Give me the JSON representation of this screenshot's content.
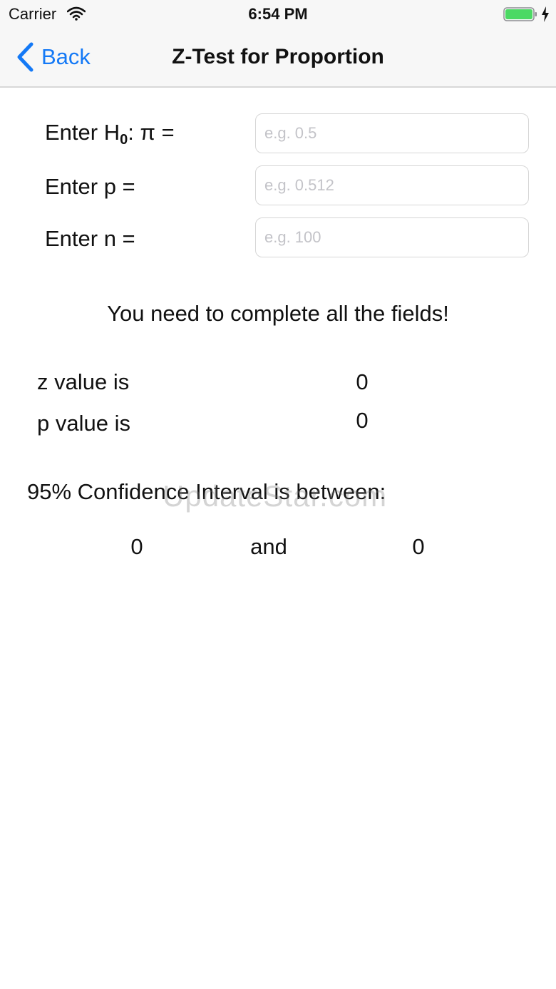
{
  "status_bar": {
    "carrier": "Carrier",
    "time": "6:54 PM"
  },
  "nav": {
    "back_label": "Back",
    "title": "Z-Test for Proportion"
  },
  "form": {
    "h0": {
      "label_prefix": "Enter H",
      "label_subscript": "0",
      "label_suffix": ": π =",
      "placeholder": "e.g. 0.5",
      "value": ""
    },
    "p": {
      "label": "Enter p =",
      "placeholder": "e.g. 0.512",
      "value": ""
    },
    "n": {
      "label": "Enter n =",
      "placeholder": "e.g. 100",
      "value": ""
    }
  },
  "message": "You need to complete all the fields!",
  "results": {
    "z_label": "z value is",
    "z_value": "0",
    "p_label": "p value is",
    "p_value": "0"
  },
  "confidence_interval": {
    "heading": "95% Confidence Interval is between:",
    "lower": "0",
    "connector": "and",
    "upper": "0"
  },
  "watermark": "UpdateStar.com",
  "colors": {
    "accent": "#1479f6",
    "battery": "#4cd964",
    "nav_background": "#f7f7f7"
  }
}
